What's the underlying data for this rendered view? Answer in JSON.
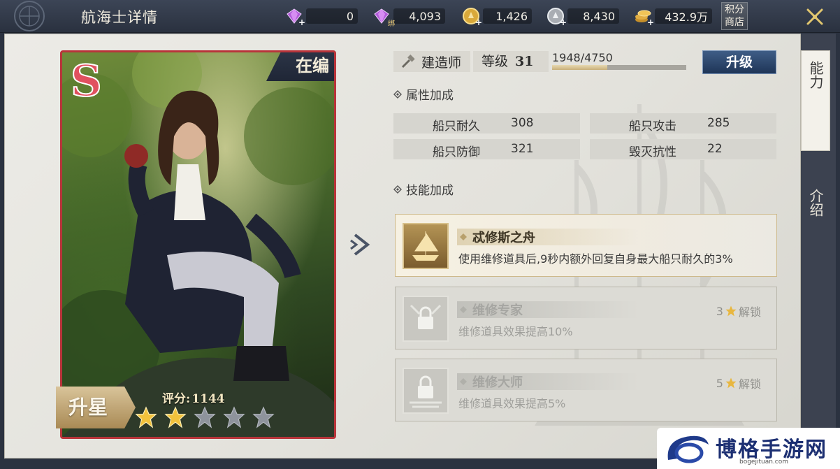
{
  "header": {
    "title": "航海士详情",
    "currencies": [
      {
        "name": "diamond",
        "icon": "purple-diamond-icon",
        "value": "0"
      },
      {
        "name": "bound-diamond",
        "icon": "purple-bound-diamond-icon",
        "value": "4,093",
        "tag": "绑"
      },
      {
        "name": "gold-coin",
        "icon": "gold-coin-icon",
        "value": "1,426"
      },
      {
        "name": "silver-coin",
        "icon": "silver-coin-icon",
        "value": "8,430"
      },
      {
        "name": "coin-stack",
        "icon": "coin-stack-icon",
        "value": "432.9万"
      }
    ],
    "shop_label": "积分商店"
  },
  "side_tabs": {
    "ability": "能力",
    "intro": "介绍"
  },
  "card": {
    "rank": "S",
    "status": "在编",
    "star_up_label": "升星",
    "score_label": "评分:",
    "score_value": "1144",
    "stars_filled": 2,
    "stars_total": 5
  },
  "info": {
    "job": "建造师",
    "level_label": "等级",
    "level_value": "31",
    "xp_text": "1948/4750",
    "xp_fraction": 0.41,
    "upgrade_label": "升级"
  },
  "attributes": {
    "title": "属性加成",
    "items": [
      {
        "label": "船只耐久",
        "value": "308"
      },
      {
        "label": "船只攻击",
        "value": "285"
      },
      {
        "label": "船只防御",
        "value": "321"
      },
      {
        "label": "毁灭抗性",
        "value": "22"
      }
    ]
  },
  "skills": {
    "title": "技能加成",
    "items": [
      {
        "name": "忒修斯之舟",
        "desc": "使用维修道具后,9秒内额外回复自身最大船只耐久的3%",
        "locked": false
      },
      {
        "name": "维修专家",
        "desc": "维修道具效果提高10%",
        "locked": true,
        "unlock_stars": "3",
        "unlock_label": "解锁"
      },
      {
        "name": "维修大师",
        "desc": "维修道具效果提高5%",
        "locked": true,
        "unlock_stars": "5",
        "unlock_label": "解锁"
      }
    ]
  },
  "watermark": {
    "text": "博格手游网",
    "sub": "bogejituan.com"
  },
  "colors": {
    "card_border": "#b8343a",
    "upgrade_button": "#2a4670",
    "gold": "#d9b24a"
  }
}
